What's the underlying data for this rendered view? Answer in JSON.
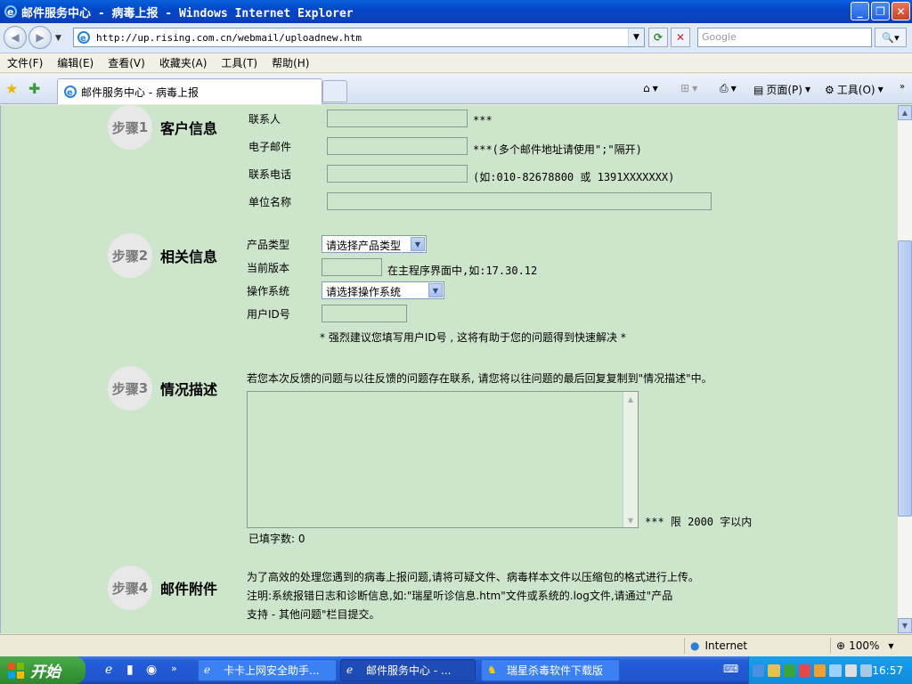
{
  "window": {
    "title": "邮件服务中心 - 病毒上报 - Windows Internet Explorer",
    "minimize": "_",
    "restore": "❐",
    "close": "✕"
  },
  "address": {
    "url": "http://up.rising.com.cn/webmail/uploadnew.htm",
    "search_placeholder": "Google"
  },
  "menu": [
    "文件(F)",
    "编辑(E)",
    "查看(V)",
    "收藏夹(A)",
    "工具(T)",
    "帮助(H)"
  ],
  "tabbar": {
    "tab_title": "邮件服务中心 - 病毒上报",
    "page_label": "页面(P)",
    "tools_label": "工具(O)"
  },
  "steps": {
    "step1": {
      "prefix": "步骤",
      "num": "1",
      "title": "客户信息"
    },
    "step2": {
      "prefix": "步骤",
      "num": "2",
      "title": "相关信息"
    },
    "step3": {
      "prefix": "步骤",
      "num": "3",
      "title": "情况描述"
    },
    "step4": {
      "prefix": "步骤",
      "num": "4",
      "title": "邮件附件"
    }
  },
  "customer": {
    "contact_label": "联系人",
    "contact_hint": "***",
    "email_label": "电子邮件",
    "email_hint": "***(多个邮件地址请使用\";\"隔开)",
    "phone_label": "联系电话",
    "phone_hint": "(如:010-82678800 或 1391XXXXXXX)",
    "company_label": "单位名称"
  },
  "related": {
    "product_label": "产品类型",
    "product_value": "请选择产品类型",
    "version_label": "当前版本",
    "version_hint": "在主程序界面中,如:17.30.12",
    "os_label": "操作系统",
    "os_value": "请选择操作系统",
    "userid_label": "用户ID号",
    "userid_note": "* 强烈建议您填写用户ID号 , 这将有助于您的问题得到快速解决 *"
  },
  "description": {
    "intro": "若您本次反馈的问题与以往反馈的问题存在联系, 请您将以往问题的最后回复复制到\"情况描述\"中。",
    "limit": "*** 限 2000 字以内",
    "count_label": "已填字数:",
    "count_value": "0"
  },
  "attachment": {
    "line1": "为了高效的处理您遇到的病毒上报问题,请将可疑文件、病毒样本文件以压缩包的格式进行上传。",
    "line2": "注明:系统报错日志和诊断信息,如:\"瑞星听诊信息.htm\"文件或系统的.log文件,请通过\"产品",
    "line3": "支持 - 其他问题\"栏目提交。"
  },
  "status": {
    "zone": "Internet",
    "zoom": "100%"
  },
  "taskbar": {
    "start": "开始",
    "tasks": [
      "卡卡上网安全助手...",
      "邮件服务中心 - ...",
      "瑞星杀毒软件下载版"
    ],
    "clock": "16:57"
  },
  "colors": {
    "page_bg": "#cde6cb",
    "titlebar": "#0a5fd8",
    "taskbar": "#245edb"
  }
}
